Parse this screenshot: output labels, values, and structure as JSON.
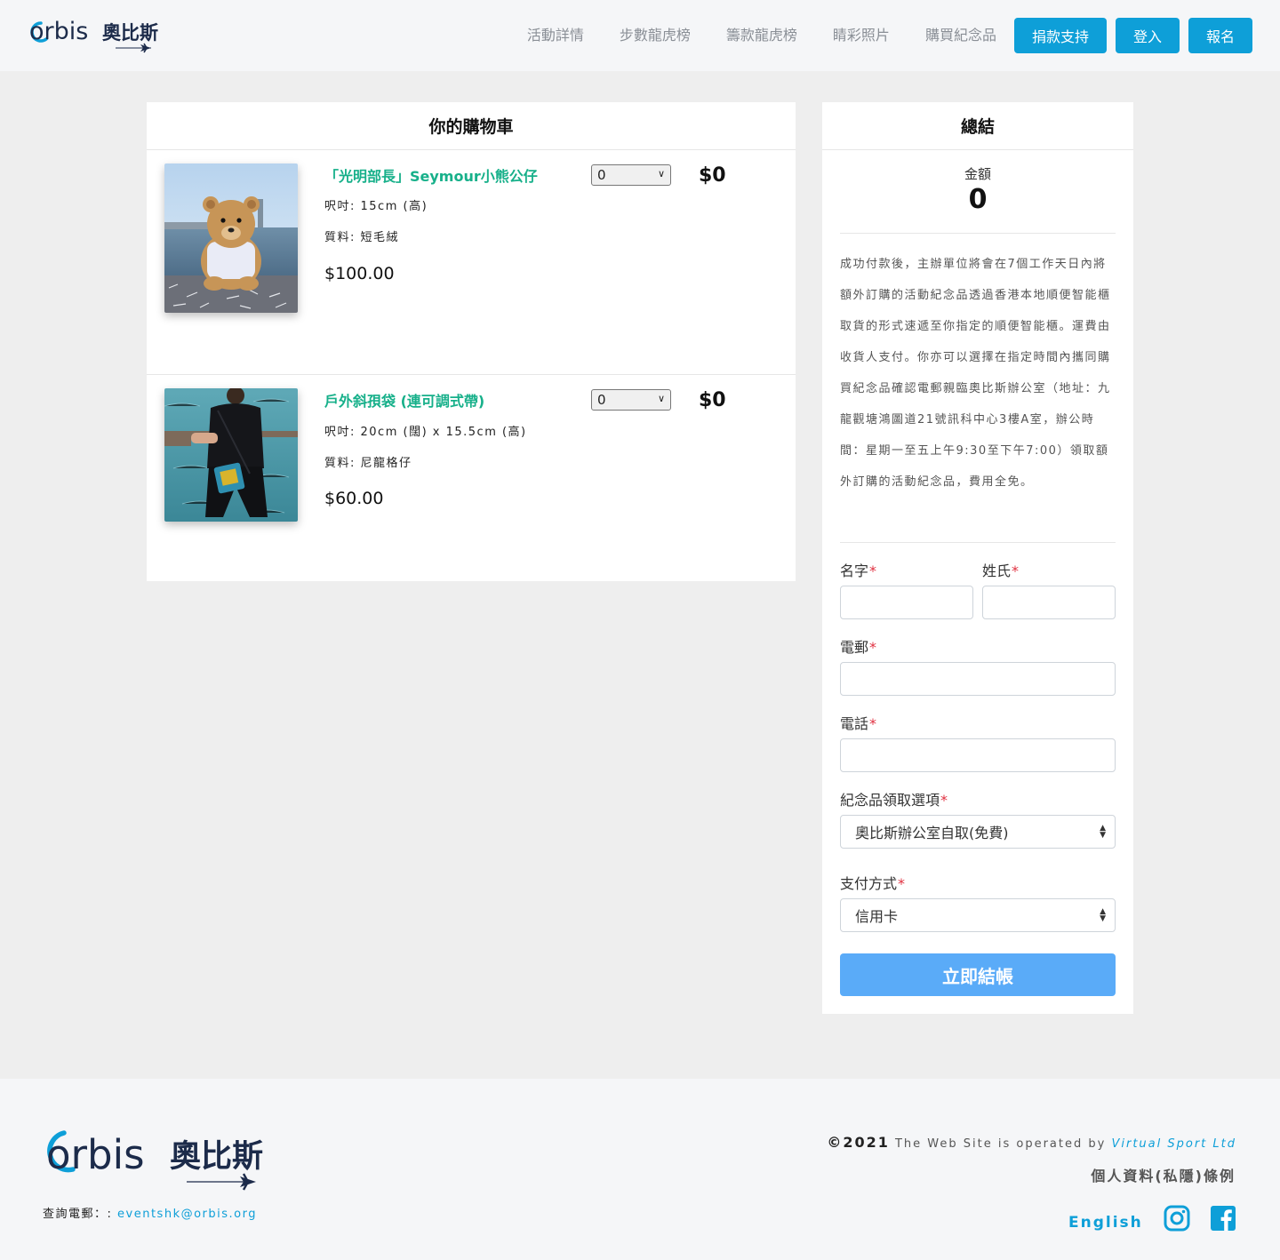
{
  "header": {
    "logo_text": "orbis",
    "logo_chinese": "奧比斯",
    "nav_links": [
      "活動詳情",
      "步數龍虎榜",
      "籌款龍虎榜",
      "睛彩照片",
      "購買紀念品"
    ],
    "buttons": {
      "donate": "捐款支持",
      "login": "登入",
      "register": "報名"
    }
  },
  "cart": {
    "title": "你的購物車",
    "items": [
      {
        "name": "「光明部長」Seymour小熊公仔",
        "size": "呎吋: 15cm (高)",
        "material": "質料: 短毛絨",
        "price": "$100.00",
        "quantity": "0",
        "line_total": "$0",
        "image_icon": "teddy-bear-photo"
      },
      {
        "name": "戶外斜孭袋 (連可調式帶)",
        "size": "呎吋: 20cm (闊) x 15.5cm (高)",
        "material": "質料: 尼龍格仔",
        "price": "$60.00",
        "quantity": "0",
        "line_total": "$0",
        "image_icon": "crossbody-bag-photo"
      }
    ]
  },
  "summary": {
    "title": "總結",
    "amount_label": "金額",
    "amount_value": "0",
    "notice": "成功付款後，主辦單位將會在7個工作天日內將額外訂購的活動紀念品透過香港本地順便智能櫃取貨的形式速遞至你指定的順便智能櫃。運費由收貨人支付。你亦可以選擇在指定時間內攜同購買紀念品確認電郵親臨奧比斯辦公室（地址：九龍觀塘鴻圖道21號訊科中心3樓A室，辦公時間：星期一至五上午9:30至下午7:00）領取額外訂購的活動紀念品，費用全免。",
    "fields": {
      "first_name": "名字",
      "last_name": "姓氏",
      "email": "電郵",
      "phone": "電話",
      "pickup": "紀念品領取選項",
      "payment": "支付方式"
    },
    "required_mark": "*",
    "pickup_value": "奧比斯辦公室自取(免費)",
    "payment_value": "信用卡",
    "checkout_label": "立即結帳"
  },
  "footer": {
    "contact_label": "查詢電郵：:",
    "contact_email": "eventshk@orbis.org",
    "copyright_year": "©2021",
    "copyright_text": "The Web Site is operated by",
    "operator": "Virtual Sport Ltd",
    "privacy": "個人資料(私隱)條例",
    "language": "English",
    "social_icons": [
      "instagram-icon",
      "facebook-icon"
    ]
  },
  "colors": {
    "brand_blue": "#0e9fd8",
    "product_green": "#17b08a",
    "checkout_blue": "#5aabf8",
    "required_red": "#e03040"
  }
}
